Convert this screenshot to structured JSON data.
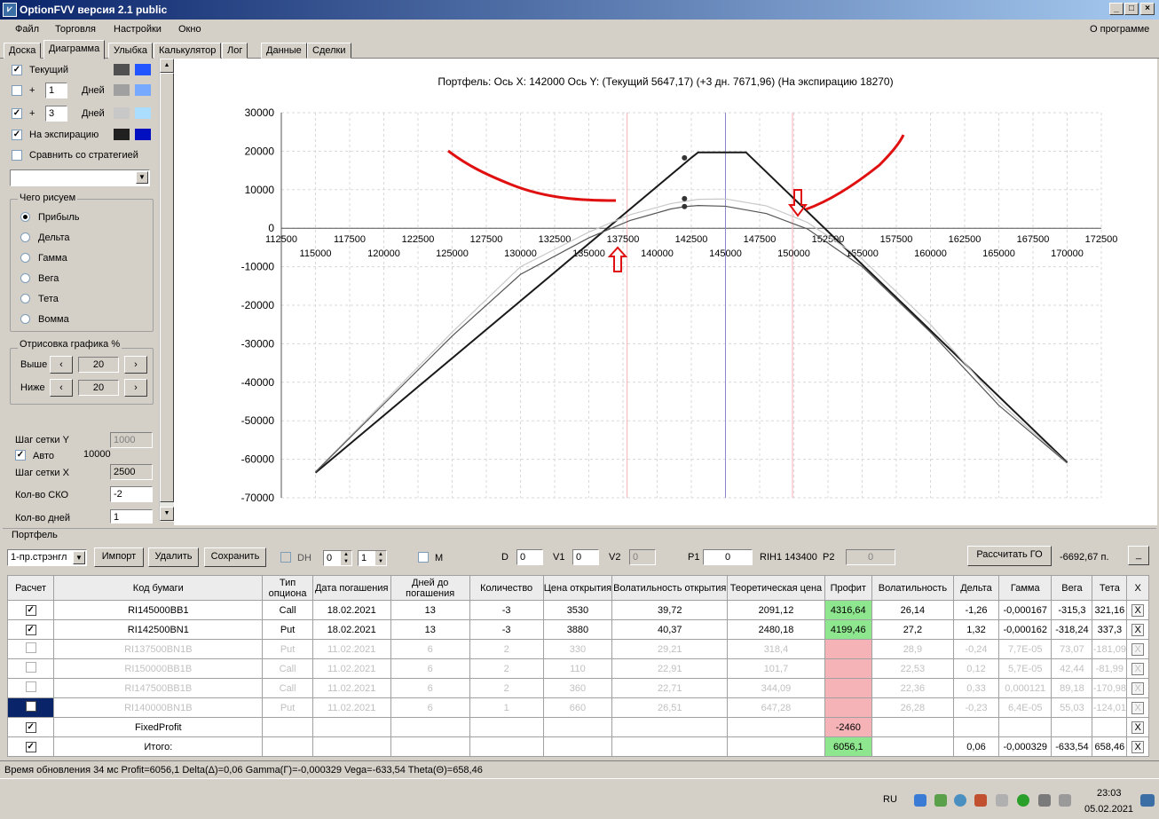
{
  "window": {
    "title": "OptionFVV версия 2.1 public"
  },
  "menu": {
    "items": [
      "Файл",
      "Торговля",
      "Настройки",
      "Окно"
    ],
    "about": "О программе"
  },
  "tabs": [
    "Доска",
    "Диаграмма",
    "Улыбка",
    "Калькулятор",
    "Лог",
    "Данные",
    "Сделки"
  ],
  "left_panel": {
    "current_label": "Текущий",
    "plus1": "+",
    "plus1_days": "1",
    "days_label": "Дней",
    "plus2": "+",
    "plus2_days": "3",
    "days_label2": "Дней",
    "expiry_label": "На экспирацию",
    "compare_label": "Сравнить со стратегией",
    "what_draw_title": "Чего рисуем",
    "options": [
      "Прибыль",
      "Дельта",
      "Гамма",
      "Вега",
      "Тета",
      "Вомма"
    ],
    "render_title": "Отрисовка графика %",
    "above_label": "Выше",
    "above_value": "20",
    "below_label": "Ниже",
    "below_value": "20",
    "grid_step_y_label": "Шаг сетки Y",
    "grid_step_y_value": "1000",
    "auto_label": "Авто",
    "auto_value": "10000",
    "grid_step_x_label": "Шаг сетки X",
    "grid_step_x_value": "2500",
    "sko_label": "Кол-во СКО",
    "sko_value": "-2",
    "days_count_label": "Кол-во дней",
    "days_count_value": "1",
    "colors": {
      "cur1": "#505050",
      "cur2": "#2255ff",
      "p1a": "#a0a0a0",
      "p1b": "#77aaff",
      "p2a": "#c8c8c8",
      "p2b": "#aaddff",
      "exa": "#202020",
      "exb": "#0010c0"
    }
  },
  "chart_data": {
    "type": "line",
    "title": "Портфель: Ось X: 142000 Ось Y:  (Текущий 5647,17)  (+3 дн. 7671,96)  (На экспирацию 18270)",
    "xlim": [
      112500,
      172500
    ],
    "ylim": [
      -70000,
      30000
    ],
    "x_ticks_upper": [
      "112500",
      "117500",
      "122500",
      "127500",
      "132500",
      "137500",
      "142500",
      "147500",
      "152500",
      "157500",
      "162500",
      "167500",
      "172500"
    ],
    "x_ticks_lower": [
      "115000",
      "120000",
      "125000",
      "130000",
      "135000",
      "140000",
      "145000",
      "150000",
      "155000",
      "160000",
      "165000",
      "170000"
    ],
    "y_ticks": [
      "30000",
      "20000",
      "10000",
      "0",
      "-10000",
      "-20000",
      "-30000",
      "-40000",
      "-50000",
      "-60000",
      "-70000"
    ],
    "series": [
      {
        "color": "#1a1a1a",
        "x": [
          115000,
          142500,
          143000,
          146500,
          170000
        ],
        "y": [
          -63500,
          18300,
          19700,
          19700,
          -60800
        ]
      },
      {
        "color": "#c8c8c8",
        "x": [
          115000,
          125000,
          130000,
          135000,
          138000,
          141000,
          143000,
          145000,
          148000,
          151000,
          155000,
          160000,
          165000,
          170000
        ],
        "y": [
          -63200,
          -27000,
          -10000,
          -1000,
          3500,
          6400,
          7500,
          7600,
          5800,
          1500,
          -8000,
          -25000,
          -45000,
          -61000
        ]
      },
      {
        "color": "#555555",
        "x": [
          115000,
          125000,
          130000,
          135000,
          138000,
          141000,
          142000,
          143000,
          145000,
          148000,
          151000,
          155000,
          160000,
          165000,
          170000
        ],
        "y": [
          -63300,
          -28000,
          -12000,
          -2500,
          2000,
          5000,
          5600,
          5900,
          5700,
          3800,
          -200,
          -10000,
          -27000,
          -46000,
          -61000
        ]
      }
    ],
    "markers": [
      {
        "x": 142000,
        "y": 18270
      },
      {
        "x": 142000,
        "y": 7671
      },
      {
        "x": 142000,
        "y": 5647
      }
    ],
    "vlines": [
      {
        "x": 137800,
        "color": "#f5b0b8"
      },
      {
        "x": 145000,
        "color": "#8888cc"
      },
      {
        "x": 149900,
        "color": "#f5b0b8"
      }
    ]
  },
  "portfolio": {
    "title": "Портфель",
    "strategy": "1-пр.стрэнгл",
    "import": "Импорт",
    "delete": "Удалить",
    "save": "Сохранить",
    "dh": "DH",
    "dh_v1": "0",
    "dh_v2": "1",
    "m": "M",
    "d": "D",
    "d_val": "0",
    "v1": "V1",
    "v1_val": "0",
    "v2": "V2",
    "v2_val": "0",
    "p1": "P1",
    "p1_val": "0",
    "ticker": "RIH1 143400",
    "p2": "P2",
    "p2_val": "0",
    "calc_go": "Рассчитать ГО",
    "go_value": "-6692,67 п.",
    "minimize": "_"
  },
  "table": {
    "headers": [
      "Расчет",
      "Код бумаги",
      "Тип опциона",
      "Дата погашения",
      "Дней до погашения",
      "Количество",
      "Цена открытия",
      "Волатильность открытия",
      "Теоретическая цена",
      "Профит",
      "Волатильность",
      "Дельта",
      "Гамма",
      "Вега",
      "Тета",
      "X"
    ],
    "rows": [
      {
        "chk": "✓",
        "code": "RI145000BB1",
        "type": "Call",
        "date": "18.02.2021",
        "days": "13",
        "qty": "-3",
        "price": "3530",
        "vol_open": "39,72",
        "theor": "2091,12",
        "profit": "4316,64",
        "vol": "26,14",
        "delta": "-1,26",
        "gamma": "-0,000167",
        "vega": "-315,3",
        "theta": "321,16",
        "x": "X"
      },
      {
        "chk": "✓",
        "code": "RI142500BN1",
        "type": "Put",
        "date": "18.02.2021",
        "days": "13",
        "qty": "-3",
        "price": "3880",
        "vol_open": "40,37",
        "theor": "2480,18",
        "profit": "4199,46",
        "vol": "27,2",
        "delta": "1,32",
        "gamma": "-0,000162",
        "vega": "-318,24",
        "theta": "337,3",
        "x": "X"
      },
      {
        "chk": "",
        "code": "RI137500BN1B",
        "type": "Put",
        "date": "11.02.2021",
        "days": "6",
        "qty": "2",
        "price": "330",
        "vol_open": "29,21",
        "theor": "318,4",
        "profit": "",
        "vol": "28,9",
        "delta": "-0,24",
        "gamma": "7,7E-05",
        "vega": "73,07",
        "theta": "-181,09",
        "x": "X"
      },
      {
        "chk": "",
        "code": "RI150000BB1B",
        "type": "Call",
        "date": "11.02.2021",
        "days": "6",
        "qty": "2",
        "price": "110",
        "vol_open": "22,91",
        "theor": "101,7",
        "profit": "",
        "vol": "22,53",
        "delta": "0,12",
        "gamma": "5,7E-05",
        "vega": "42,44",
        "theta": "-81,99",
        "x": "X"
      },
      {
        "chk": "",
        "code": "RI147500BB1B",
        "type": "Call",
        "date": "11.02.2021",
        "days": "6",
        "qty": "2",
        "price": "360",
        "vol_open": "22,71",
        "theor": "344,09",
        "profit": "",
        "vol": "22,36",
        "delta": "0,33",
        "gamma": "0,000121",
        "vega": "89,18",
        "theta": "-170,98",
        "x": "X"
      },
      {
        "chk": "",
        "code": "RI140000BN1B",
        "type": "Put",
        "date": "11.02.2021",
        "days": "6",
        "qty": "1",
        "price": "660",
        "vol_open": "26,51",
        "theor": "647,28",
        "profit": "",
        "vol": "26,28",
        "delta": "-0,23",
        "gamma": "6,4E-05",
        "vega": "55,03",
        "theta": "-124,01",
        "x": "X"
      }
    ],
    "fixed": {
      "chk": "✓",
      "code": "FixedProfit",
      "profit": "-2460",
      "x": "X"
    },
    "total": {
      "chk": "✓",
      "code": "Итого:",
      "profit": "6056,1",
      "delta": "0,06",
      "gamma": "-0,000329",
      "vega": "-633,54",
      "theta": "658,46",
      "x": "X"
    }
  },
  "status": {
    "text": "Время обновления 34 мс  Profit=6056,1 Delta(Δ)=0,06 Gamma(Γ)=-0,000329 Vega=-633,54 Theta(Θ)=658,46"
  },
  "taskbar": {
    "lang": "RU",
    "time": "23:03",
    "date": "05.02.2021"
  }
}
